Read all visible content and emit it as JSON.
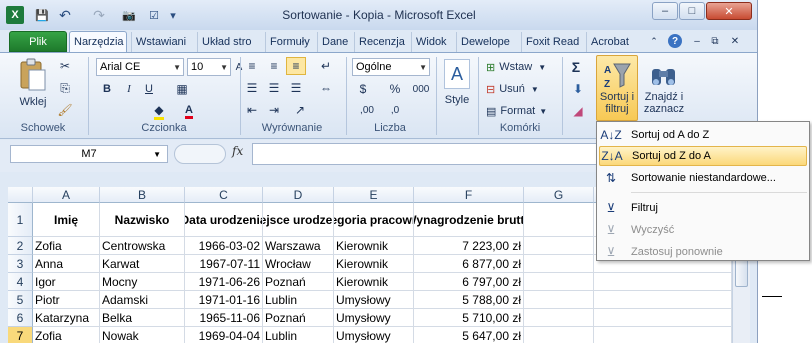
{
  "window": {
    "title": "Sortowanie - Kopia  -  Microsoft Excel",
    "controls": {
      "minimize": "–",
      "maximize": "□",
      "close": "✕"
    },
    "inner_controls": {
      "minimize": "–",
      "restore": "⧉",
      "close": "✕"
    }
  },
  "quick_access": {
    "excel_icon": "X",
    "save": "💾",
    "undo": "↶",
    "redo": "↷",
    "camera": "📷",
    "form": "☑",
    "more": "▾"
  },
  "tabs": [
    "Plik",
    "Narzędzia",
    "Wstawiani",
    "Układ stro",
    "Formuły",
    "Dane",
    "Recenzja",
    "Widok",
    "Dewelope",
    "Foxit Read",
    "Acrobat"
  ],
  "tab_icons": {
    "help": "?",
    "minimize_ribbon": "⌃"
  },
  "ribbon": {
    "clipboard": {
      "label": "Schowek",
      "paste": "Wklej"
    },
    "font": {
      "label": "Czcionka",
      "name": "Arial CE",
      "size": "10",
      "bold": "B",
      "italic": "I",
      "underline": "U"
    },
    "alignment": {
      "label": "Wyrównanie"
    },
    "number": {
      "label": "Liczba",
      "format": "Ogólne",
      "currency": "$",
      "percent": "%",
      "thousands": "000",
      "inc": ",00",
      "dec": ",0"
    },
    "styles": {
      "label": "Style"
    },
    "cells": {
      "label": "Komórki",
      "insert": "Wstaw",
      "delete": "Usuń",
      "format": "Format"
    },
    "editing": {
      "sort_line1": "Sortuj i",
      "sort_line2": "filtruj",
      "find_line1": "Znajdź i",
      "find_line2": "zaznacz"
    }
  },
  "formula_bar": {
    "name_box": "M7",
    "fx": "fx",
    "value": ""
  },
  "columns": [
    "A",
    "B",
    "C",
    "D",
    "E",
    "F",
    "G"
  ],
  "header_row": {
    "row": "1",
    "cells": [
      "Imię",
      "Nazwisko",
      "Data urodzenia",
      "Miejsce urodzenia",
      "Kategoria pracownika",
      "Wynagrodzenie brutto",
      ""
    ]
  },
  "rows": [
    {
      "row": "2",
      "cells": [
        "Zofia",
        "Centrowska",
        "1966-03-02",
        "Warszawa",
        "Kierownik",
        "7 223,00 zł"
      ]
    },
    {
      "row": "3",
      "cells": [
        "Anna",
        "Karwat",
        "1967-07-11",
        "Wrocław",
        "Kierownik",
        "6 877,00 zł"
      ]
    },
    {
      "row": "4",
      "cells": [
        "Igor",
        "Mocny",
        "1971-06-26",
        "Poznań",
        "Kierownik",
        "6 797,00 zł"
      ]
    },
    {
      "row": "5",
      "cells": [
        "Piotr",
        "Adamski",
        "1971-01-16",
        "Lublin",
        "Umysłowy",
        "5 788,00 zł"
      ]
    },
    {
      "row": "6",
      "cells": [
        "Katarzyna",
        "Belka",
        "1965-11-06",
        "Poznań",
        "Umysłowy",
        "5 710,00 zł"
      ]
    },
    {
      "row": "7",
      "cells": [
        "Zofia",
        "Nowak",
        "1969-04-04",
        "Lublin",
        "Umysłowy",
        "5 647,00 zł"
      ]
    }
  ],
  "sort_menu": {
    "items": [
      {
        "label": "Sortuj od A do Z",
        "icon": "sort-az-icon",
        "glyph": "A↓Z"
      },
      {
        "label": "Sortuj od Z do A",
        "icon": "sort-za-icon",
        "glyph": "Z↓A"
      },
      {
        "label": "Sortowanie niestandardowe...",
        "icon": "custom-sort-icon",
        "glyph": "⇅"
      },
      {
        "label": "Filtruj",
        "icon": "filter-icon",
        "glyph": "⊻"
      },
      {
        "label": "Wyczyść",
        "icon": "clear-filter-icon",
        "glyph": "⊻"
      },
      {
        "label": "Zastosuj ponownie",
        "icon": "reapply-icon",
        "glyph": "⊻"
      }
    ]
  }
}
